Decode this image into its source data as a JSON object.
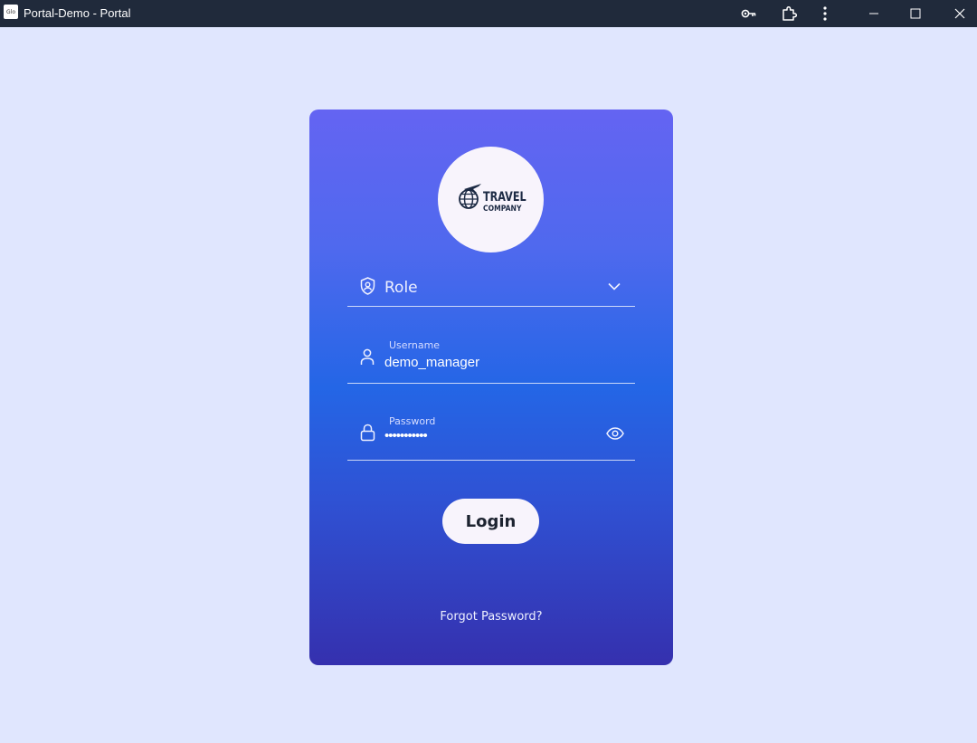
{
  "window": {
    "app_icon_text": "Glo",
    "title": "Portal-Demo - Portal",
    "icons": [
      "key-icon",
      "extension-icon",
      "more-options-icon",
      "minimize-icon",
      "maximize-icon",
      "close-icon"
    ]
  },
  "logo": {
    "line1": "TRAVEL",
    "line2": "COMPANY"
  },
  "form": {
    "role_label": "Role",
    "username_label": "Username",
    "username_value": "demo_manager",
    "password_label": "Password",
    "password_value": "•••••••••••",
    "login_label": "Login",
    "forgot_label": "Forgot Password?"
  },
  "colors": {
    "page_background": "#e0e6fe",
    "titlebar": "#202a3b",
    "card_gradient_top": "#6464f2",
    "card_gradient_bottom": "#3530ae",
    "button_background": "#f8f4fc"
  }
}
